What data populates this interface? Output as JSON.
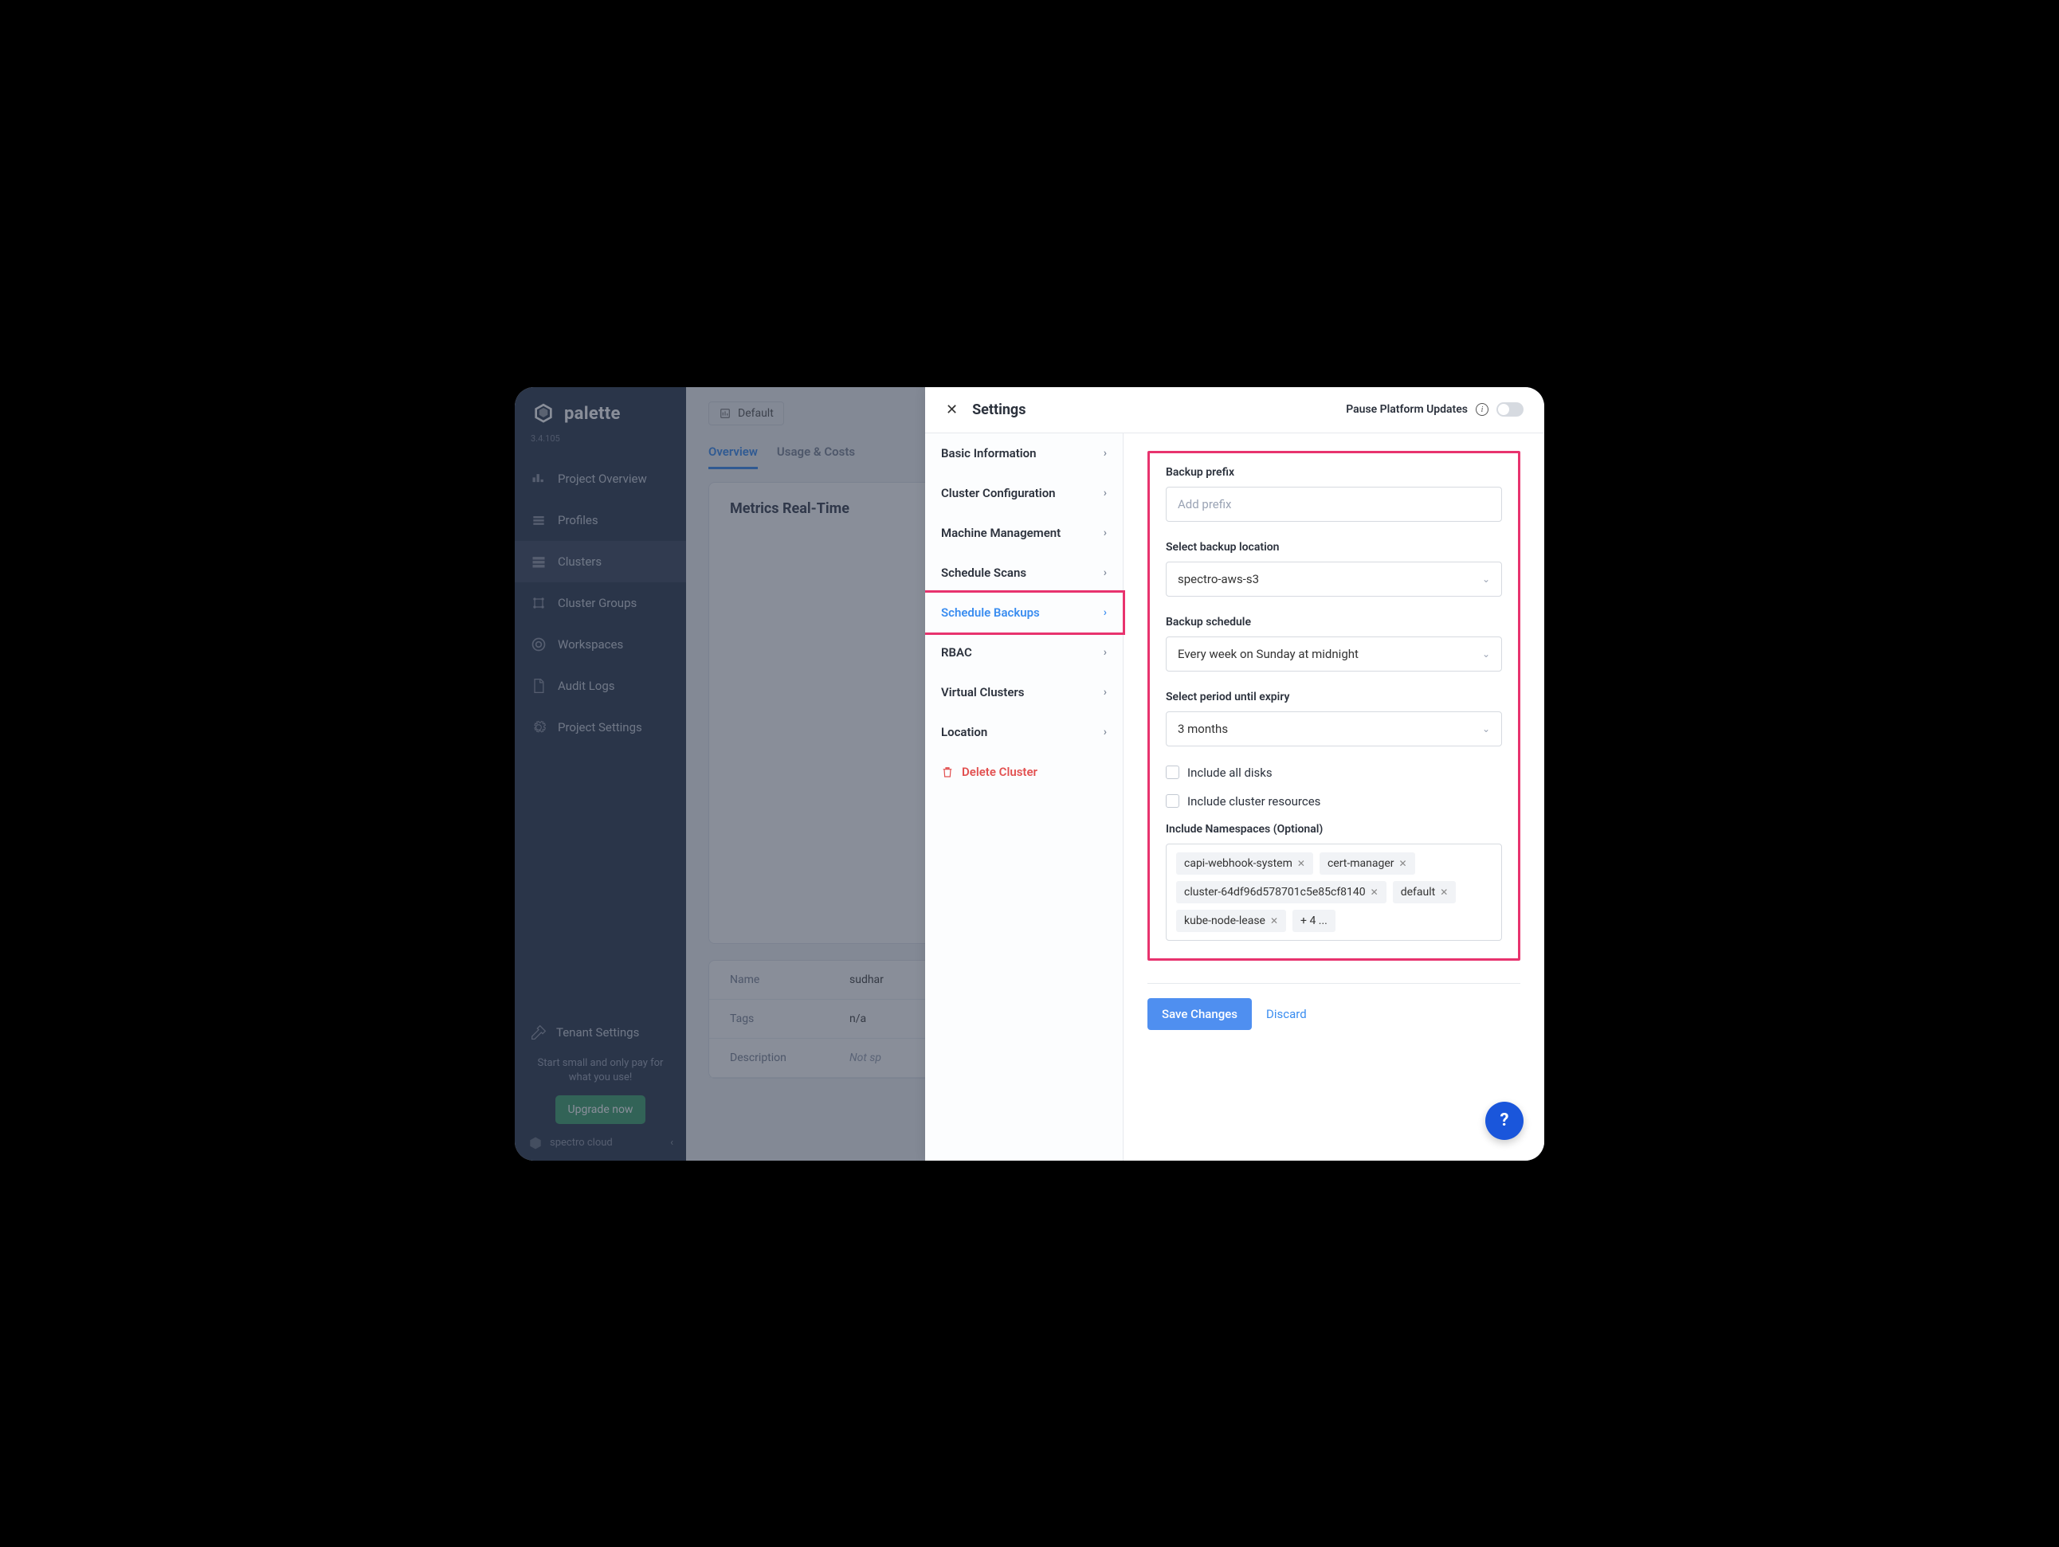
{
  "logo": "palette",
  "version": "3.4.105",
  "sidebar": {
    "items": [
      {
        "label": "Project Overview"
      },
      {
        "label": "Profiles"
      },
      {
        "label": "Clusters",
        "active": true
      },
      {
        "label": "Cluster Groups"
      },
      {
        "label": "Workspaces"
      },
      {
        "label": "Audit Logs"
      },
      {
        "label": "Project Settings"
      }
    ],
    "tenant": "Tenant Settings",
    "promo": "Start small and only pay for what you use!",
    "upgrade": "Upgrade now",
    "footer_brand": "spectro cloud"
  },
  "crumb": "Default",
  "tabs": [
    {
      "label": "Overview",
      "active": true
    },
    {
      "label": "Usage & Costs"
    }
  ],
  "metrics_title": "Metrics Real-Time",
  "meta": [
    {
      "label": "Name",
      "value": "sudhar"
    },
    {
      "label": "Tags",
      "value": "n/a"
    },
    {
      "label": "Description",
      "value": "Not sp"
    }
  ],
  "settings": {
    "title": "Settings",
    "pause_label": "Pause Platform Updates",
    "menu": [
      {
        "label": "Basic Information"
      },
      {
        "label": "Cluster Configuration"
      },
      {
        "label": "Machine Management"
      },
      {
        "label": "Schedule Scans"
      },
      {
        "label": "Schedule Backups",
        "active": true
      },
      {
        "label": "RBAC"
      },
      {
        "label": "Virtual Clusters"
      },
      {
        "label": "Location"
      }
    ],
    "delete": "Delete Cluster",
    "form": {
      "prefix_label": "Backup prefix",
      "prefix_placeholder": "Add prefix",
      "location_label": "Select backup location",
      "location_value": "spectro-aws-s3",
      "schedule_label": "Backup schedule",
      "schedule_value": "Every week on Sunday at midnight",
      "expiry_label": "Select period until expiry",
      "expiry_value": "3 months",
      "include_disks": "Include all disks",
      "include_resources": "Include cluster resources",
      "namespaces_label": "Include Namespaces (Optional)",
      "namespaces": [
        "capi-webhook-system",
        "cert-manager",
        "cluster-64df96d578701c5e85cf8140",
        "default",
        "kube-node-lease"
      ],
      "namespaces_more": "+ 4 ...",
      "save": "Save Changes",
      "discard": "Discard"
    }
  }
}
